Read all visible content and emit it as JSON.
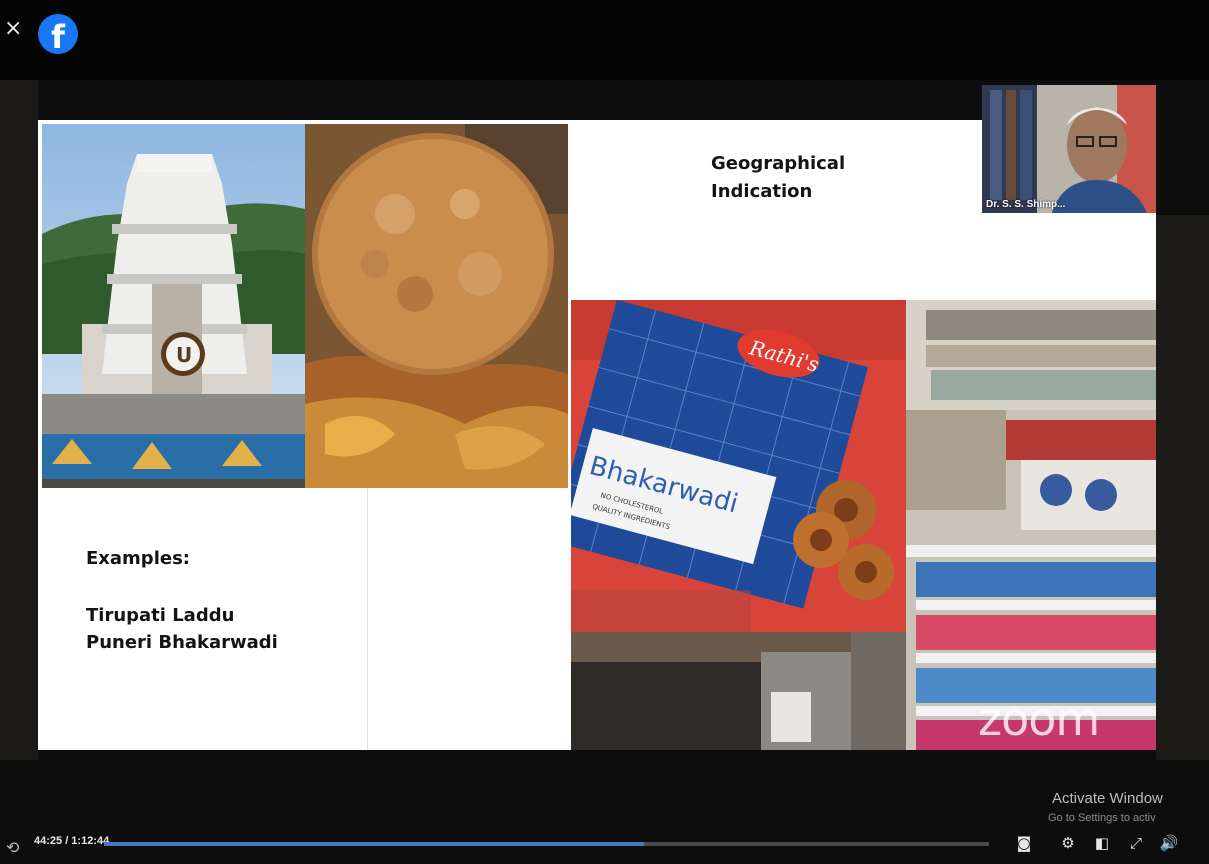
{
  "app": {
    "close_glyph": "×",
    "logo_glyph": "f",
    "logo_color": "#1877f2"
  },
  "slide": {
    "title_line1": "Geographical",
    "title_line2": "Indication",
    "examples_label": "Examples:",
    "examples": [
      "Tirupati Laddu",
      "Puneri Bhakarwadi"
    ],
    "images": {
      "packet_brand": "Rathi's",
      "packet_label": "Bhakarwadi",
      "packet_line1": "NO CHOLESTEROL",
      "packet_line2": "QUALITY INGREDIENTS"
    }
  },
  "webcam": {
    "participant_name": "Dr. S. S. Shimp..."
  },
  "watermark": {
    "text": "zoom"
  },
  "windows_notice": {
    "title": "Activate Window",
    "subtitle": "Go to Settings to activ"
  },
  "player": {
    "time": "44:25 / 1:12:44",
    "progress_fraction": 0.61,
    "accent": "#4a76c8",
    "icons": [
      "replay-icon",
      "captions-icon",
      "settings-icon",
      "pip-icon",
      "fullscreen-icon",
      "volume-icon"
    ]
  }
}
